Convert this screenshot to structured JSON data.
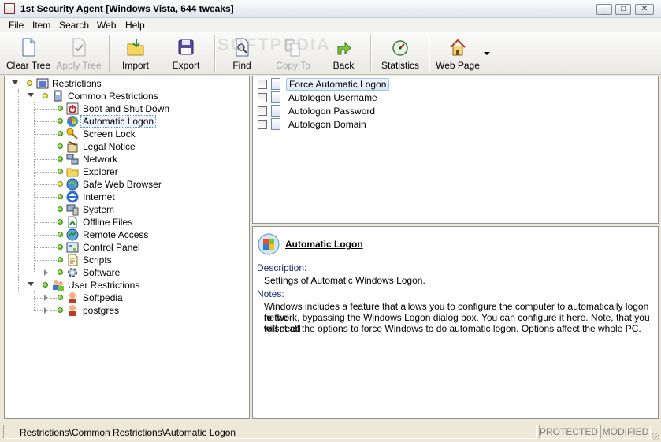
{
  "window": {
    "title": "1st Security Agent [Windows Vista, 644 tweaks]",
    "minimize": "–",
    "maximize": "□",
    "close": "✕"
  },
  "menu": [
    "File",
    "Item",
    "Search",
    "Web",
    "Help"
  ],
  "toolbar": {
    "clear_tree": "Clear Tree",
    "apply_tree": "Apply Tree",
    "import": "Import",
    "export": "Export",
    "find": "Find",
    "copy_to": "Copy To",
    "back": "Back",
    "statistics": "Statistics",
    "web_page": "Web Page"
  },
  "tree": {
    "root": "Restrictions",
    "common": "Common Restrictions",
    "common_items": [
      "Boot and Shut Down",
      "Automatic Logon",
      "Screen Lock",
      "Legal Notice",
      "Network",
      "Explorer",
      "Safe Web Browser",
      "Internet",
      "System",
      "Offline Files",
      "Remote Access",
      "Control Panel",
      "Scripts",
      "Software"
    ],
    "user": "User Restrictions",
    "user_items": [
      "Softpedia",
      "postgres"
    ]
  },
  "options": [
    "Force Automatic Logon",
    "Autologon Username",
    "Autologon Password",
    "Autologon Domain"
  ],
  "description": {
    "title": "Automatic Logon",
    "desc_label": "Description:",
    "desc_text": "Settings of Automatic Windows Logon.",
    "notes_label": "Notes:",
    "notes_line1": "Windows includes a feature that allows you to configure the computer to automatically logon to the",
    "notes_line2": "network, bypassing the Windows Logon dialog box. You can configure it here. Note, that you will need",
    "notes_line3": "to set all the options to force Windows to do automatic logon. Options affect the whole PC."
  },
  "status": {
    "path": "Restrictions\\Common Restrictions\\Automatic Logon",
    "protected": "PROTECTED",
    "modified": "MODIFIED"
  },
  "watermark": "SOFTPEDIA"
}
